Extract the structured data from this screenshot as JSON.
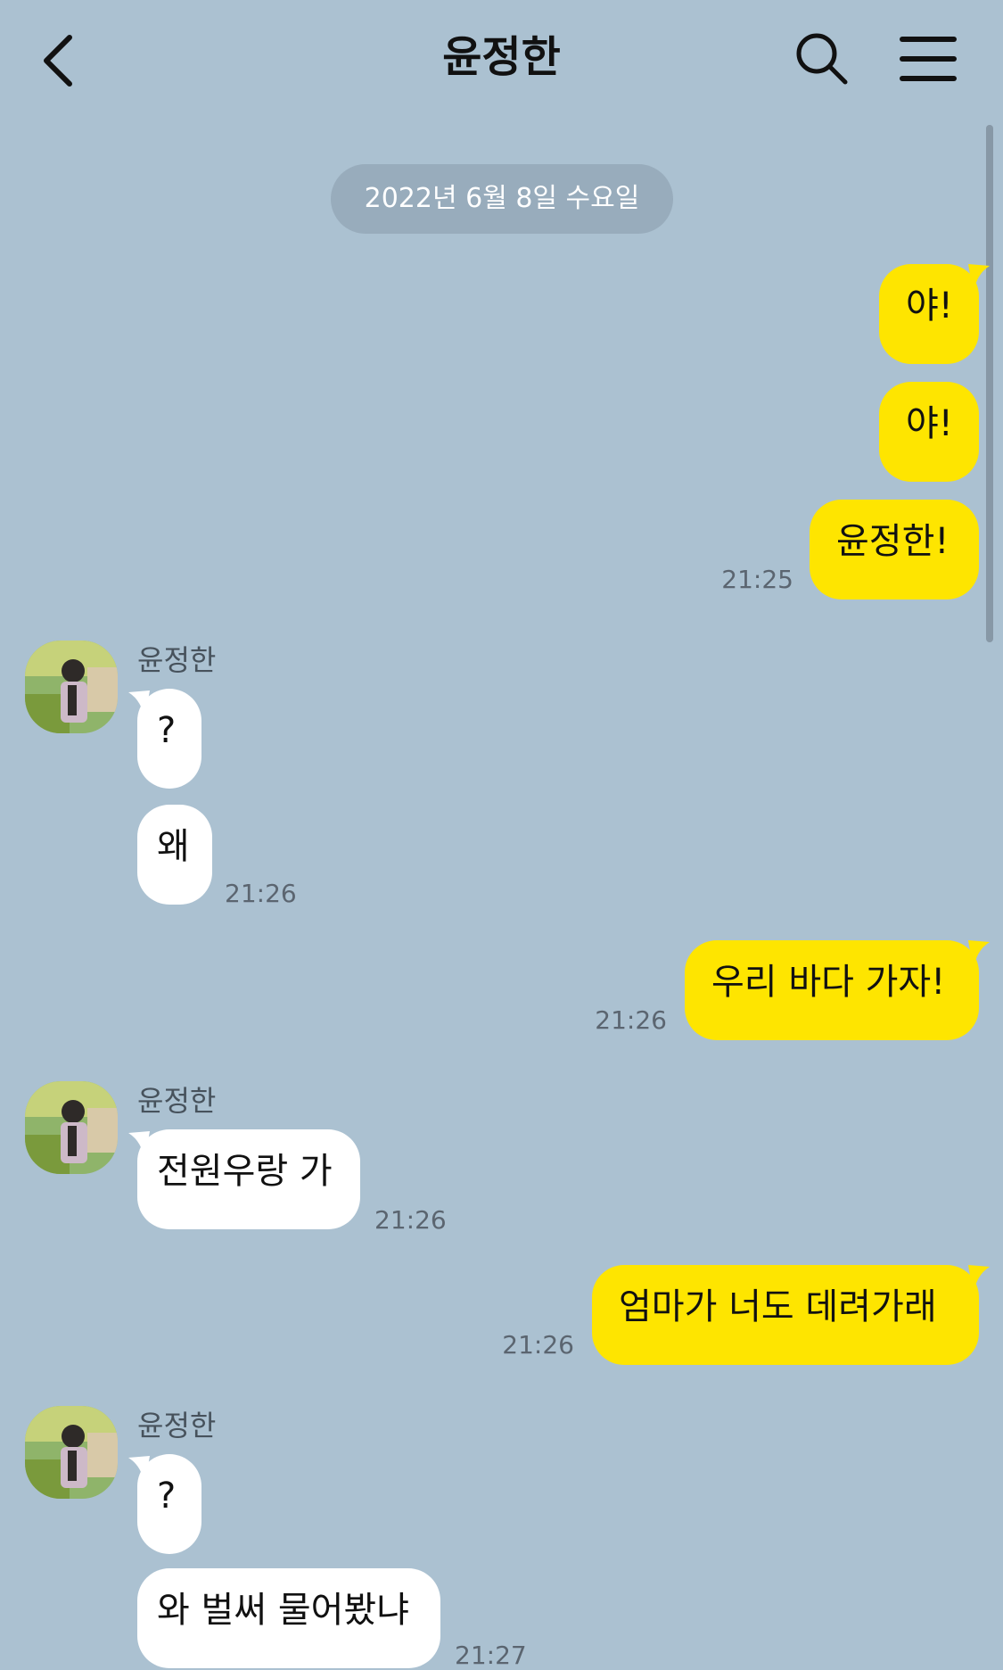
{
  "header": {
    "title": "윤정한",
    "back_icon": "chevron-left-icon",
    "search_icon": "search-icon",
    "menu_icon": "menu-icon"
  },
  "date_divider": "2022년 6월 8일 수요일",
  "colors": {
    "background": "#abc1d1",
    "my_bubble": "#fee500",
    "their_bubble": "#ffffff"
  },
  "messages": [
    {
      "sender": "me",
      "text": "야!"
    },
    {
      "sender": "me",
      "text": "야!"
    },
    {
      "sender": "me",
      "text": "윤정한!",
      "time": "21:25"
    },
    {
      "sender": "윤정한",
      "text": "?"
    },
    {
      "sender": "윤정한",
      "text": "왜",
      "time": "21:26"
    },
    {
      "sender": "me",
      "text": "우리 바다 가자!",
      "time": "21:26"
    },
    {
      "sender": "윤정한",
      "text": "전원우랑 가",
      "time": "21:26"
    },
    {
      "sender": "me",
      "text": "엄마가 너도 데려가래",
      "time": "21:26"
    },
    {
      "sender": "윤정한",
      "text": "?"
    },
    {
      "sender": "윤정한",
      "text": "와 벌써 물어봤냐",
      "time": "21:27"
    }
  ]
}
